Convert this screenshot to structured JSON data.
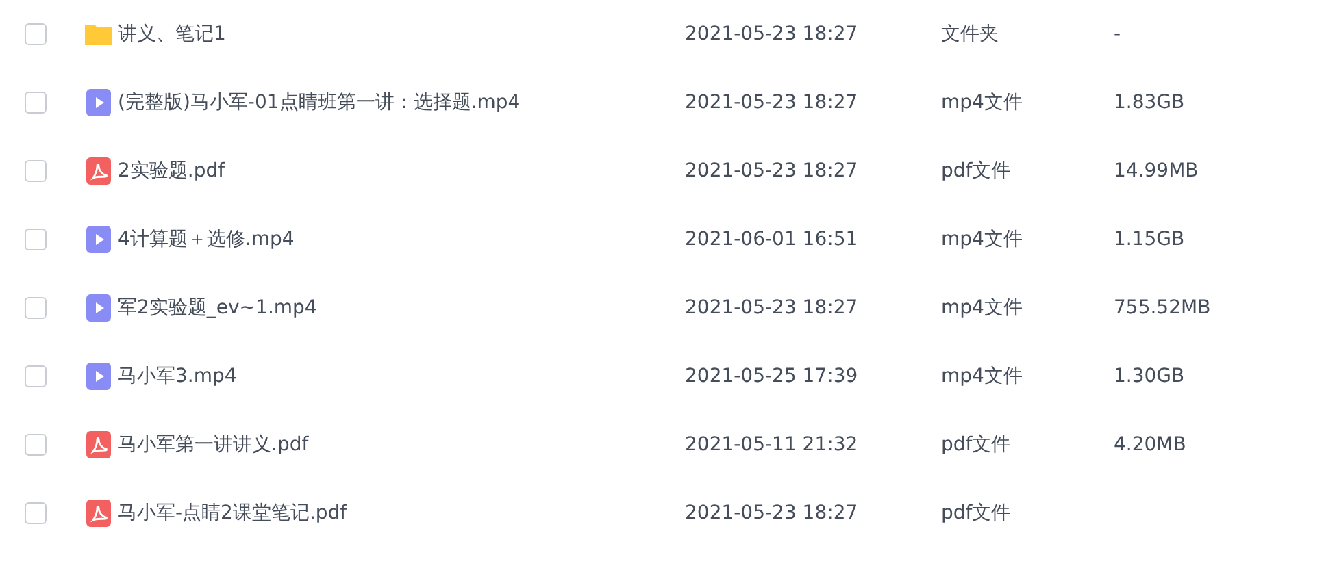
{
  "files": [
    {
      "kind": "folder",
      "name": "讲义、笔记1",
      "modified": "2021-05-23 18:27",
      "type": "文件夹",
      "size": "-",
      "checked": false
    },
    {
      "kind": "video",
      "name": "(完整版)马小军-01点睛班第一讲：选择题.mp4",
      "modified": "2021-05-23 18:27",
      "type": "mp4文件",
      "size": "1.83GB",
      "checked": false
    },
    {
      "kind": "pdf",
      "name": "2实验题.pdf",
      "modified": "2021-05-23 18:27",
      "type": "pdf文件",
      "size": "14.99MB",
      "checked": false
    },
    {
      "kind": "video",
      "name": "4计算题＋选修.mp4",
      "modified": "2021-06-01 16:51",
      "type": "mp4文件",
      "size": "1.15GB",
      "checked": false
    },
    {
      "kind": "video",
      "name": "军2实验题_ev~1.mp4",
      "modified": "2021-05-23 18:27",
      "type": "mp4文件",
      "size": "755.52MB",
      "checked": false
    },
    {
      "kind": "video",
      "name": "马小军3.mp4",
      "modified": "2021-05-25 17:39",
      "type": "mp4文件",
      "size": "1.30GB",
      "checked": false
    },
    {
      "kind": "pdf",
      "name": "马小军第一讲讲义.pdf",
      "modified": "2021-05-11 21:32",
      "type": "pdf文件",
      "size": "4.20MB",
      "checked": false
    },
    {
      "kind": "pdf",
      "name": "马小军-点睛2课堂笔记.pdf",
      "modified": "2021-05-23 18:27",
      "type": "pdf文件",
      "checked": false
    }
  ]
}
